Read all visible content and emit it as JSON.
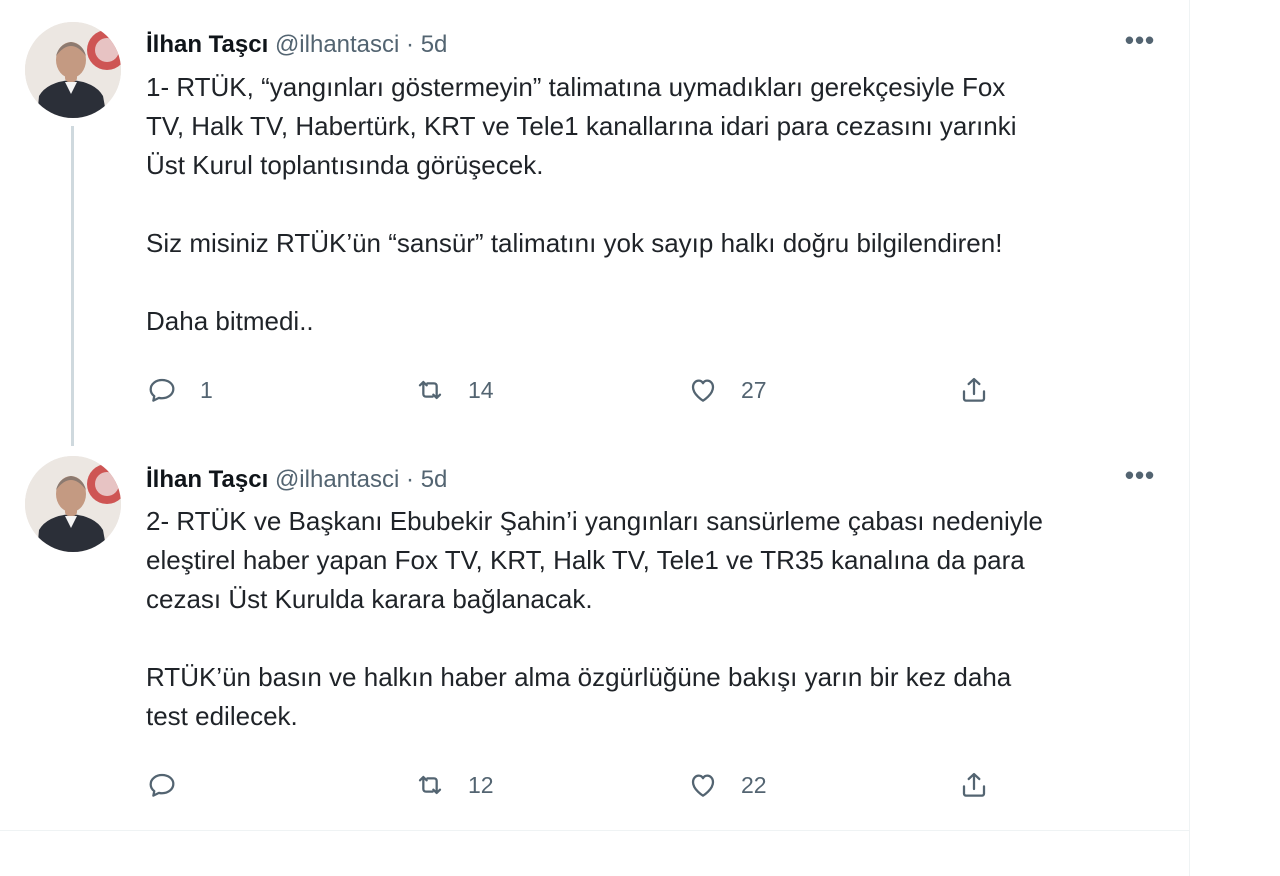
{
  "tweets": [
    {
      "name": "İlhan Taşcı",
      "handle": "@ilhantasci",
      "separator": "·",
      "time": "5d",
      "text": "1- RTÜK, “yangınları göstermeyin” talimatına uymadıkları gerekçesiyle Fox\nTV, Halk TV, Habertürk, KRT ve Tele1 kanallarına idari para cezasını yarınki\nÜst Kurul toplantısında görüşecek.\n\nSiz misiniz RTÜK’ün “sansür” talimatını yok sayıp halkı doğru bilgilendiren!\n\nDaha bitmedi..",
      "reply_count": "1",
      "retweet_count": "14",
      "like_count": "27"
    },
    {
      "name": "İlhan Taşcı",
      "handle": "@ilhantasci",
      "separator": "·",
      "time": "5d",
      "text": "2- RTÜK ve Başkanı Ebubekir Şahin’i yangınları sansürleme çabası nedeniyle\neleştirel haber yapan Fox TV, KRT, Halk TV, Tele1 ve TR35 kanalına da para\ncezası Üst Kurulda karara bağlanacak.\n\nRTÜK’ün basın ve halkın haber alma özgürlüğüne bakışı yarın bir kez daha\ntest edilecek.",
      "reply_count": "",
      "retweet_count": "12",
      "like_count": "22"
    }
  ],
  "icons": {
    "more": "more-horizontal-icon",
    "reply": "reply-icon",
    "retweet": "retweet-icon",
    "like": "heart-icon",
    "share": "share-icon"
  },
  "colors": {
    "text_primary": "#0f1419",
    "text_secondary": "#536471",
    "thread_line": "#cfd9de",
    "divider": "#eff3f4"
  }
}
